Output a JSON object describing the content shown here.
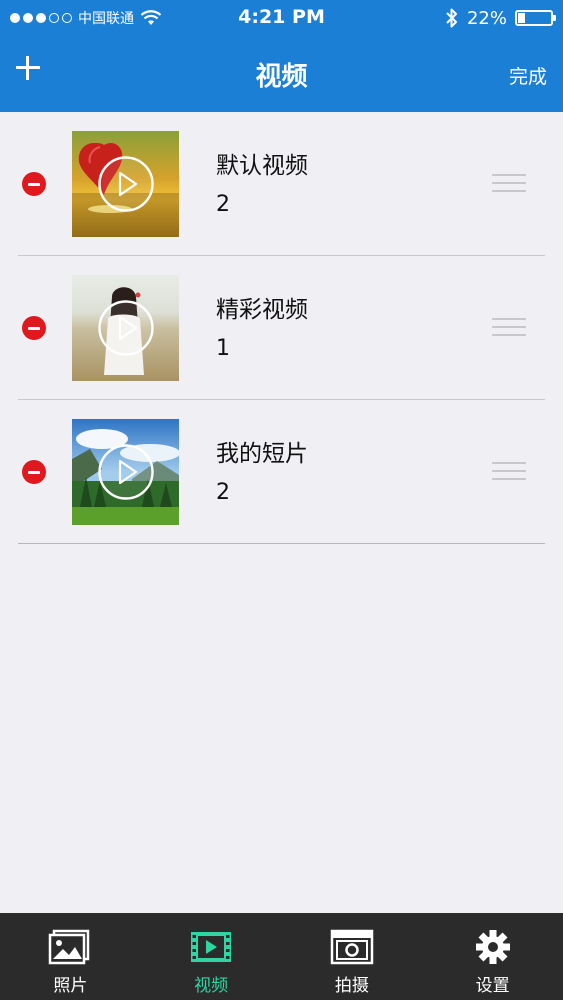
{
  "status_bar": {
    "carrier": "中国联通",
    "time": "4:21 PM",
    "battery_percent": "22%",
    "battery_level": 0.22
  },
  "nav": {
    "title": "视频",
    "done_label": "完成"
  },
  "albums": [
    {
      "title": "默认视频",
      "count": "2"
    },
    {
      "title": "精彩视频",
      "count": "1"
    },
    {
      "title": "我的短片",
      "count": "2"
    }
  ],
  "tabs": [
    {
      "label": "照片",
      "icon": "photos-icon",
      "active": false
    },
    {
      "label": "视频",
      "icon": "video-icon",
      "active": true
    },
    {
      "label": "拍摄",
      "icon": "camera-icon",
      "active": false
    },
    {
      "label": "设置",
      "icon": "gear-icon",
      "active": false
    }
  ],
  "colors": {
    "header": "#1c7fd6",
    "delete": "#e0191f",
    "tab_bar": "#2b2b2b",
    "tab_active": "#2fd5a3"
  }
}
